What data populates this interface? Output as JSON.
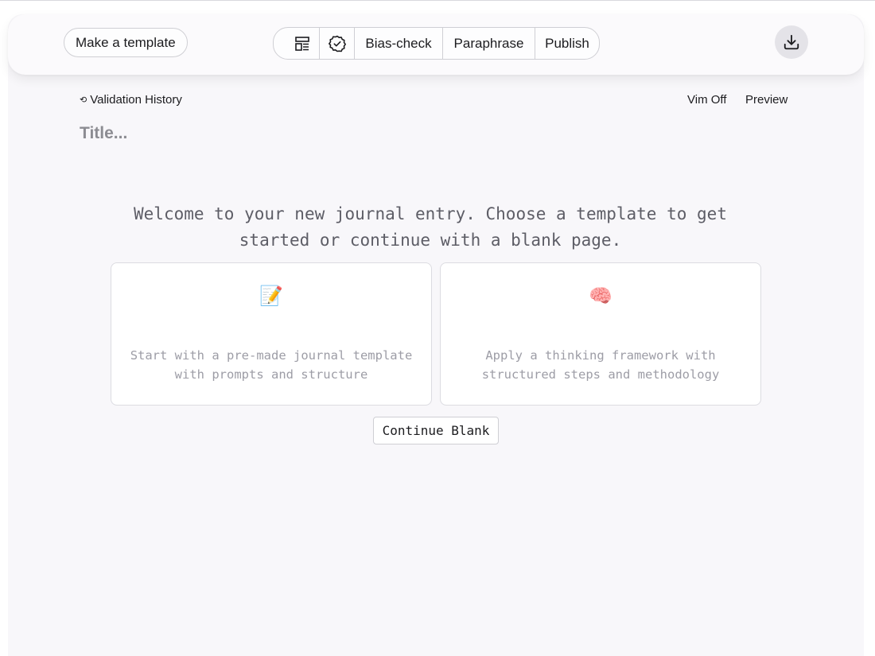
{
  "toolbar": {
    "make_template_label": "Make a template",
    "layout_icon": "layout-template-icon",
    "verify_icon": "badge-check-icon",
    "bias_check_label": "Bias-check",
    "paraphrase_label": "Paraphrase",
    "publish_label": "Publish",
    "download_icon": "download-icon"
  },
  "editor": {
    "validation_history_icon": "history-icon",
    "validation_history_label": "Validation History",
    "vim_label": "Vim Off",
    "preview_label": "Preview",
    "title_placeholder": "Title..."
  },
  "welcome": {
    "message": "Welcome to your new journal entry. Choose a template to get started or continue with a blank page.",
    "cards": [
      {
        "icon": "memo-icon",
        "emoji": "📝",
        "description": "Start with a pre-made journal template with prompts and structure"
      },
      {
        "icon": "brain-icon",
        "emoji": "🧠",
        "description": "Apply a thinking framework with structured steps and methodology"
      }
    ],
    "continue_label": "Continue Blank"
  },
  "colors": {
    "background": "#f8f7fa",
    "toolbar": "#fbfafc",
    "text": "#1c1c1f",
    "muted_text": "#9d9da6",
    "border": "#cfcfd4"
  }
}
